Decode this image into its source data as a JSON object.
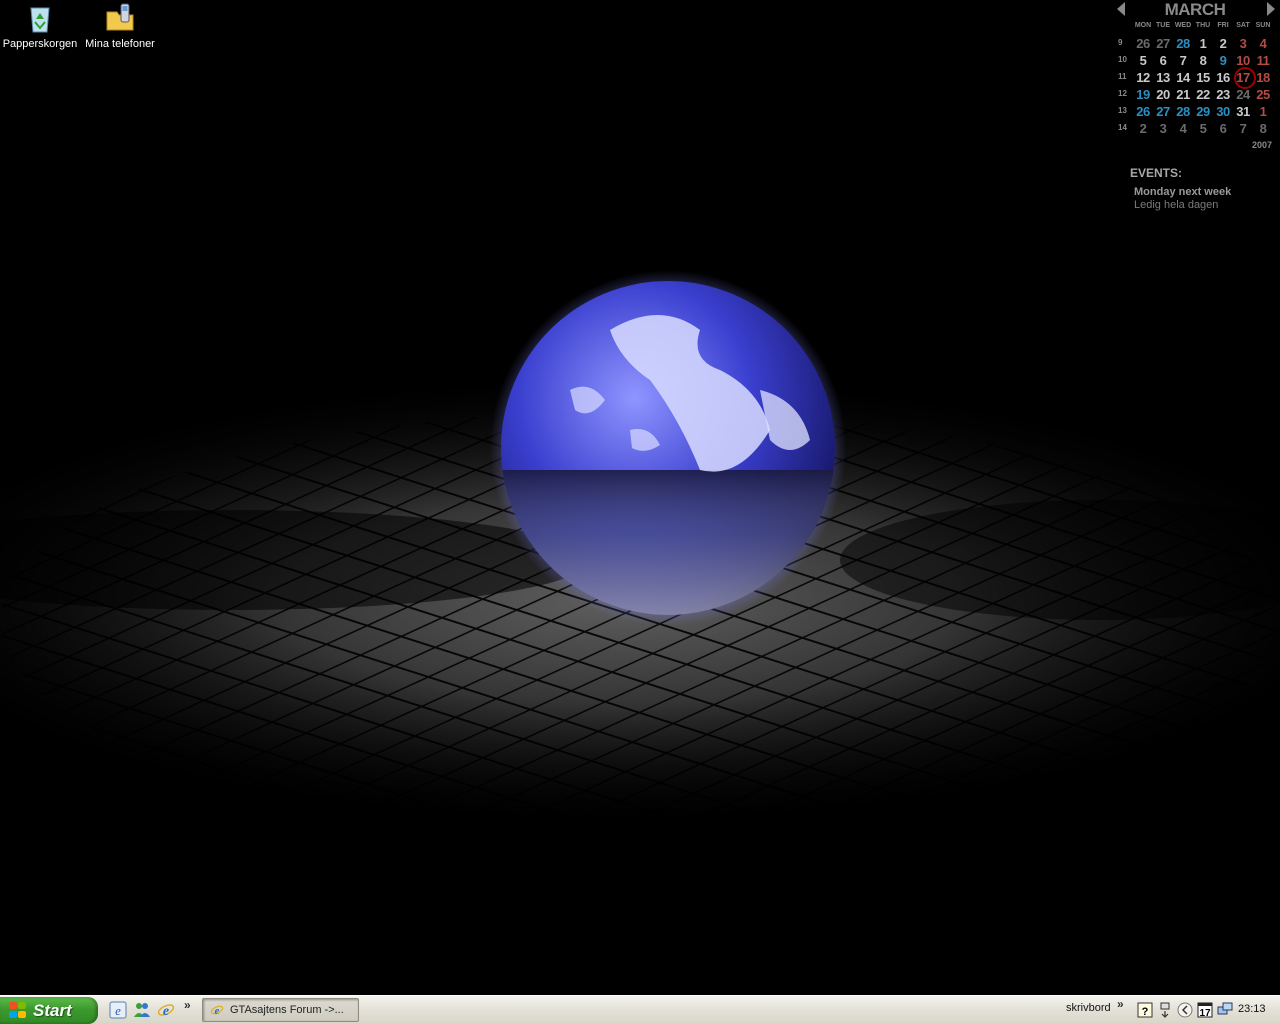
{
  "desktop": {
    "icons": [
      {
        "label": "Papperskorgen",
        "icon": "recycle-bin-icon"
      },
      {
        "label": "Mina telefoner",
        "icon": "phone-folder-icon"
      }
    ]
  },
  "calendar": {
    "month": "MARCH",
    "year": "2007",
    "day_headers": [
      "MON",
      "TUE",
      "WED",
      "THU",
      "FRI",
      "SAT",
      "SUN"
    ],
    "weeks": [
      {
        "week": "9",
        "days": [
          "26",
          "27",
          "28",
          "1",
          "2",
          "3",
          "4"
        ]
      },
      {
        "week": "10",
        "days": [
          "5",
          "6",
          "7",
          "8",
          "9",
          "10",
          "11"
        ]
      },
      {
        "week": "11",
        "days": [
          "12",
          "13",
          "14",
          "15",
          "16",
          "17",
          "18"
        ]
      },
      {
        "week": "12",
        "days": [
          "19",
          "20",
          "21",
          "22",
          "23",
          "24",
          "25"
        ]
      },
      {
        "week": "13",
        "days": [
          "26",
          "27",
          "28",
          "29",
          "30",
          "31",
          "1"
        ]
      },
      {
        "week": "14",
        "days": [
          "2",
          "3",
          "4",
          "5",
          "6",
          "7",
          "8"
        ]
      }
    ],
    "today": "17",
    "colors": {
      "normal": "#c9c9c9",
      "muted": "#6b6b6b",
      "blue": "#2c8fc0",
      "red": "#b44b44",
      "today_ring": "#a00000"
    }
  },
  "events": {
    "title": "EVENTS:",
    "items": [
      {
        "name": "Monday next week",
        "description": "Ledig hela dagen"
      }
    ]
  },
  "taskbar": {
    "start_label": "Start",
    "quick_launch": [
      "ie-icon",
      "messenger-icon",
      "ie-icon"
    ],
    "task_items": [
      {
        "label": "GTAsajtens Forum ->...",
        "icon": "ie-icon"
      }
    ],
    "desktop_toolbar_label": "skrivbord",
    "chevron": "»",
    "tray_icons": [
      "help-icon",
      "network-icon",
      "arrow-icon",
      "calendar-tray-icon",
      "network-monitor-icon"
    ],
    "clock": "23:13"
  }
}
